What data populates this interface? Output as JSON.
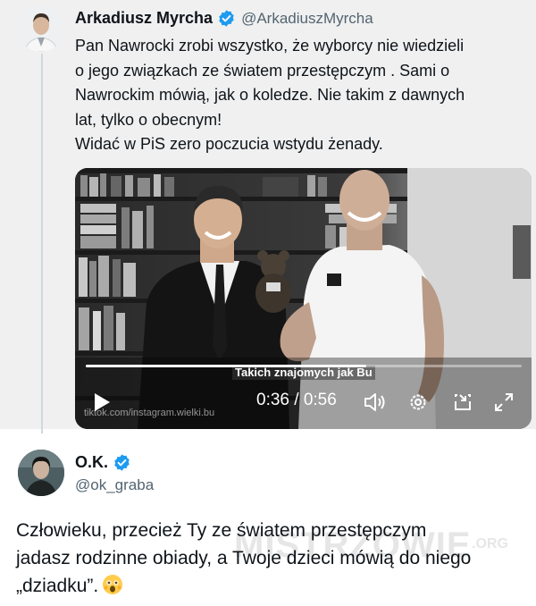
{
  "quoted_tweet": {
    "author_name": "Arkadiusz Myrcha",
    "handle": "@ArkadiuszMyrcha",
    "verified": true,
    "text_lines": [
      "Pan Nawrocki zrobi wszystko, że wyborcy nie wiedzieli",
      "o jego związkach ze światem przestępczym . Sami o",
      "Nawrockim mówią, jak o koledze. Nie takim z dawnych",
      "lat, tylko o obecnym!",
      "Widać w PiS zero poczucia wstydu żenady."
    ],
    "video": {
      "caption": "Takich znajomych jak Bu",
      "overlay_watermark": "tiktok.com/instagram.wielki.bu",
      "time_display": "0:36 / 0:56",
      "progress": 0.643,
      "controls": [
        "play-icon",
        "volume-icon",
        "settings-icon",
        "pip-icon",
        "fullscreen-icon"
      ]
    }
  },
  "reply_tweet": {
    "author_name": "O.K.",
    "handle": "@ok_graba",
    "verified": true,
    "text_lines": [
      "Człowieku, przecież Ty ze światem przestępczym",
      "jadasz rodzinne obiady, a Twoje dzieci mówią do niego",
      "„dziadku”."
    ],
    "emoji": "astonished-face"
  },
  "site_watermark": "MISTRZOWIE",
  "site_watermark_suffix": ".ORG",
  "colors": {
    "verified_blue": "#1d9bf0",
    "text_primary": "#0f1419",
    "text_secondary": "#536471",
    "quoted_background": "#f0f0f0"
  }
}
